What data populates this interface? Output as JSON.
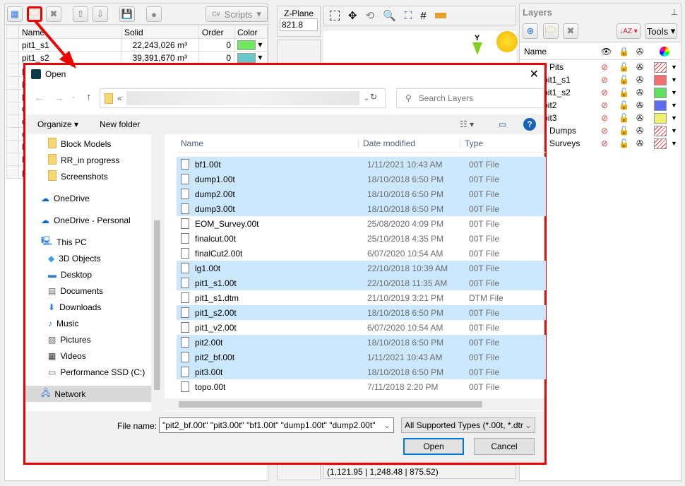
{
  "left_toolbar": {
    "scripts_label": "Scripts"
  },
  "solids_table": {
    "headers": [
      "Name",
      "Solid",
      "Order",
      "Color"
    ],
    "rows": [
      {
        "name": "pit1_s1",
        "solid": "22,243,026 m³",
        "order": "0",
        "color": "#6fe860"
      },
      {
        "name": "pit1_s2",
        "solid": "39,391,670 m³",
        "order": "0",
        "color": "#6cc8c8"
      }
    ],
    "partial_rows": [
      "p",
      "p",
      "p",
      "d",
      "d",
      "d",
      "lg",
      "b",
      "p"
    ]
  },
  "zplane": {
    "label": "Z-Plane",
    "value": "821.8"
  },
  "viewport": {
    "axis_label": "Y",
    "coords": "(1,121.95 | 1,248.48 | 875.52)"
  },
  "layers": {
    "title": "Layers",
    "tools_label": "Tools",
    "col_name": "Name",
    "items": [
      {
        "name": "Pits",
        "indent": 0,
        "color": "hatch"
      },
      {
        "name": "pit1_s1",
        "indent": 1,
        "color": "#f07070"
      },
      {
        "name": "pit1_s2",
        "indent": 1,
        "color": "#60e060"
      },
      {
        "name": "pit2",
        "indent": 1,
        "color": "#5a6cf0"
      },
      {
        "name": "pit3",
        "indent": 1,
        "color": "#f0f070"
      },
      {
        "name": "Dumps",
        "indent": 0,
        "color": "hatch"
      },
      {
        "name": "Surveys",
        "indent": 0,
        "color": "hatch"
      }
    ]
  },
  "dialog": {
    "title": "Open",
    "breadcrumb_prefix": "«",
    "search_placeholder": "Search Layers",
    "organize_label": "Organize",
    "new_folder_label": "New folder",
    "nav": [
      {
        "label": "Block Models",
        "icon": "folder",
        "indent": 1
      },
      {
        "label": "RR_in progress",
        "icon": "folder",
        "indent": 1
      },
      {
        "label": "Screenshots",
        "icon": "folder",
        "indent": 1
      },
      {
        "label": "OneDrive",
        "icon": "cloud",
        "indent": 0
      },
      {
        "label": "OneDrive - Personal",
        "icon": "cloud",
        "indent": 0
      },
      {
        "label": "This PC",
        "icon": "pc",
        "indent": 0
      },
      {
        "label": "3D Objects",
        "icon": "cube",
        "indent": 1
      },
      {
        "label": "Desktop",
        "icon": "desktop",
        "indent": 1
      },
      {
        "label": "Documents",
        "icon": "doc",
        "indent": 1
      },
      {
        "label": "Downloads",
        "icon": "download",
        "indent": 1
      },
      {
        "label": "Music",
        "icon": "music",
        "indent": 1
      },
      {
        "label": "Pictures",
        "icon": "picture",
        "indent": 1
      },
      {
        "label": "Videos",
        "icon": "video",
        "indent": 1
      },
      {
        "label": "Performance SSD (C:)",
        "icon": "drive",
        "indent": 1
      },
      {
        "label": "Network",
        "icon": "network",
        "indent": 0
      }
    ],
    "columns": [
      "Name",
      "Date modified",
      "Type"
    ],
    "files": [
      {
        "name": "bf1.00t",
        "date": "1/11/2021 10:43 AM",
        "type": "00T File",
        "selected": true
      },
      {
        "name": "dump1.00t",
        "date": "18/10/2018 6:50 PM",
        "type": "00T File",
        "selected": true
      },
      {
        "name": "dump2.00t",
        "date": "18/10/2018 6:50 PM",
        "type": "00T File",
        "selected": true
      },
      {
        "name": "dump3.00t",
        "date": "18/10/2018 6:50 PM",
        "type": "00T File",
        "selected": true
      },
      {
        "name": "EOM_Survey.00t",
        "date": "25/08/2020 4:09 PM",
        "type": "00T File",
        "selected": false
      },
      {
        "name": "finalcut.00t",
        "date": "25/10/2018 4:35 PM",
        "type": "00T File",
        "selected": false
      },
      {
        "name": "finalCut2.00t",
        "date": "6/07/2020 10:54 AM",
        "type": "00T File",
        "selected": false
      },
      {
        "name": "lg1.00t",
        "date": "22/10/2018 10:39 AM",
        "type": "00T File",
        "selected": true
      },
      {
        "name": "pit1_s1.00t",
        "date": "22/10/2018 11:35 AM",
        "type": "00T File",
        "selected": true
      },
      {
        "name": "pit1_s1.dtm",
        "date": "21/10/2019 3:21 PM",
        "type": "DTM File",
        "selected": false
      },
      {
        "name": "pit1_s2.00t",
        "date": "18/10/2018 6:50 PM",
        "type": "00T File",
        "selected": true
      },
      {
        "name": "pit1_v2.00t",
        "date": "6/07/2020 10:54 AM",
        "type": "00T File",
        "selected": false
      },
      {
        "name": "pit2.00t",
        "date": "18/10/2018 6:50 PM",
        "type": "00T File",
        "selected": true
      },
      {
        "name": "pit2_bf.00t",
        "date": "1/11/2021 10:43 AM",
        "type": "00T File",
        "selected": true
      },
      {
        "name": "pit3.00t",
        "date": "18/10/2018 6:50 PM",
        "type": "00T File",
        "selected": true
      },
      {
        "name": "topo.00t",
        "date": "7/11/2018 2:20 PM",
        "type": "00T File",
        "selected": false
      }
    ],
    "filename_label": "File name:",
    "filename_value": "\"pit2_bf.00t\" \"pit3.00t\" \"bf1.00t\" \"dump1.00t\" \"dump2.00t\"",
    "filetype_value": "All Supported Types (*.00t, *.dtr",
    "open_label": "Open",
    "cancel_label": "Cancel"
  },
  "colors": {
    "highlight": "#e00000",
    "selection": "#cce8ff"
  }
}
